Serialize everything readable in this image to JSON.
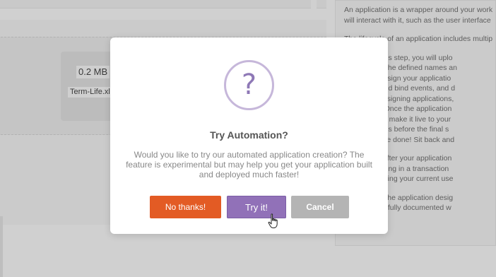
{
  "background": {
    "file": {
      "size": "0.2 MB",
      "name": "Term-Life.xl"
    },
    "sidebar": {
      "lines": [
        "An application is a wrapper around your work",
        "will interact with it, such as the user interface",
        "",
        "The lifecycle of an application includes multip",
        "",
        "on: During this step, you will uplo",
        "dentify all of the defined names an",
        "n: You will design your applicatio",
        "ols, define and bind events, and d",
        "mation on designing applications,",
        "w/Revision: Once the application",
        "ct before you make it live to your",
        "r modifications before the final s",
        "h: Now, you're done! Sit back and",
        "",
        "e a change after your application",
        "that you making in a transaction",
        "without affecting your current use",
        "",
        "ormation on the application desig",
        "ch module is fully documented w"
      ]
    }
  },
  "modal": {
    "icon": "question-mark-icon",
    "title": "Try Automation?",
    "body": "Would you like to try our automated application creation? The feature is experimental but may help you get your application built and deployed much faster!",
    "buttons": {
      "no": "No thanks!",
      "try": "Try it!",
      "cancel": "Cancel"
    }
  },
  "colors": {
    "no_button": "#e35b24",
    "try_button": "#9171b8",
    "cancel_button": "#b4b4b4",
    "icon_ring": "#c6b7da"
  }
}
